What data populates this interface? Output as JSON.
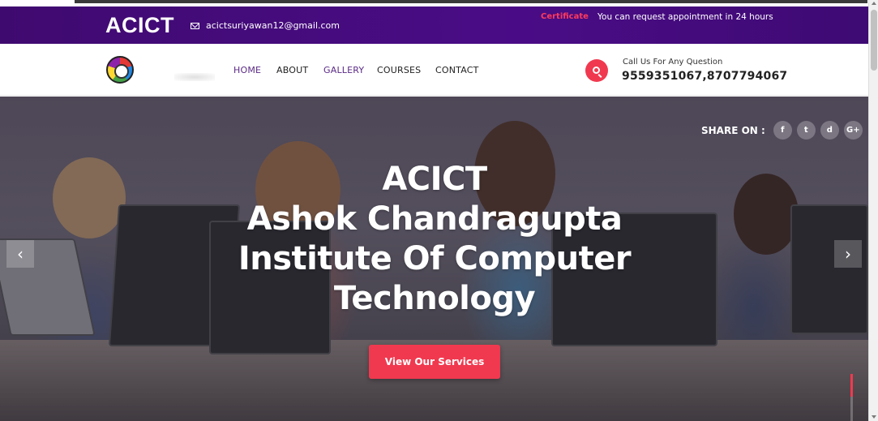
{
  "topbar": {
    "brand": "ACICT",
    "email": "acictsuriyawan12@gmail.com",
    "certificate_link": "Certificate",
    "appointment_text": "You can request appointment in 24 hours",
    "background_color": "#420b7a",
    "accent_color": "#ff3b5c"
  },
  "navbar": {
    "items": [
      {
        "label": "HOME"
      },
      {
        "label": "ABOUT"
      },
      {
        "label": "GALLERY"
      },
      {
        "label": "COURSES"
      },
      {
        "label": "CONTACT"
      }
    ],
    "call_label": "Call Us For Any Question",
    "call_number": "9559351067,8707794067",
    "search_icon": "search-icon"
  },
  "hero": {
    "share_label": "SHARE ON :",
    "share_buttons": [
      "f",
      "t",
      "d",
      "G+"
    ],
    "share_icons": [
      "facebook-icon",
      "twitter-icon",
      "dribbble-icon",
      "google-plus-icon"
    ],
    "title_lines": [
      "ACICT",
      "Ashok Chandragupta",
      "Institute Of Computer",
      "Technology"
    ],
    "cta_label": "View Our Services",
    "prev_arrow": "‹",
    "next_arrow": "›",
    "cta_color": "#f0394f"
  }
}
